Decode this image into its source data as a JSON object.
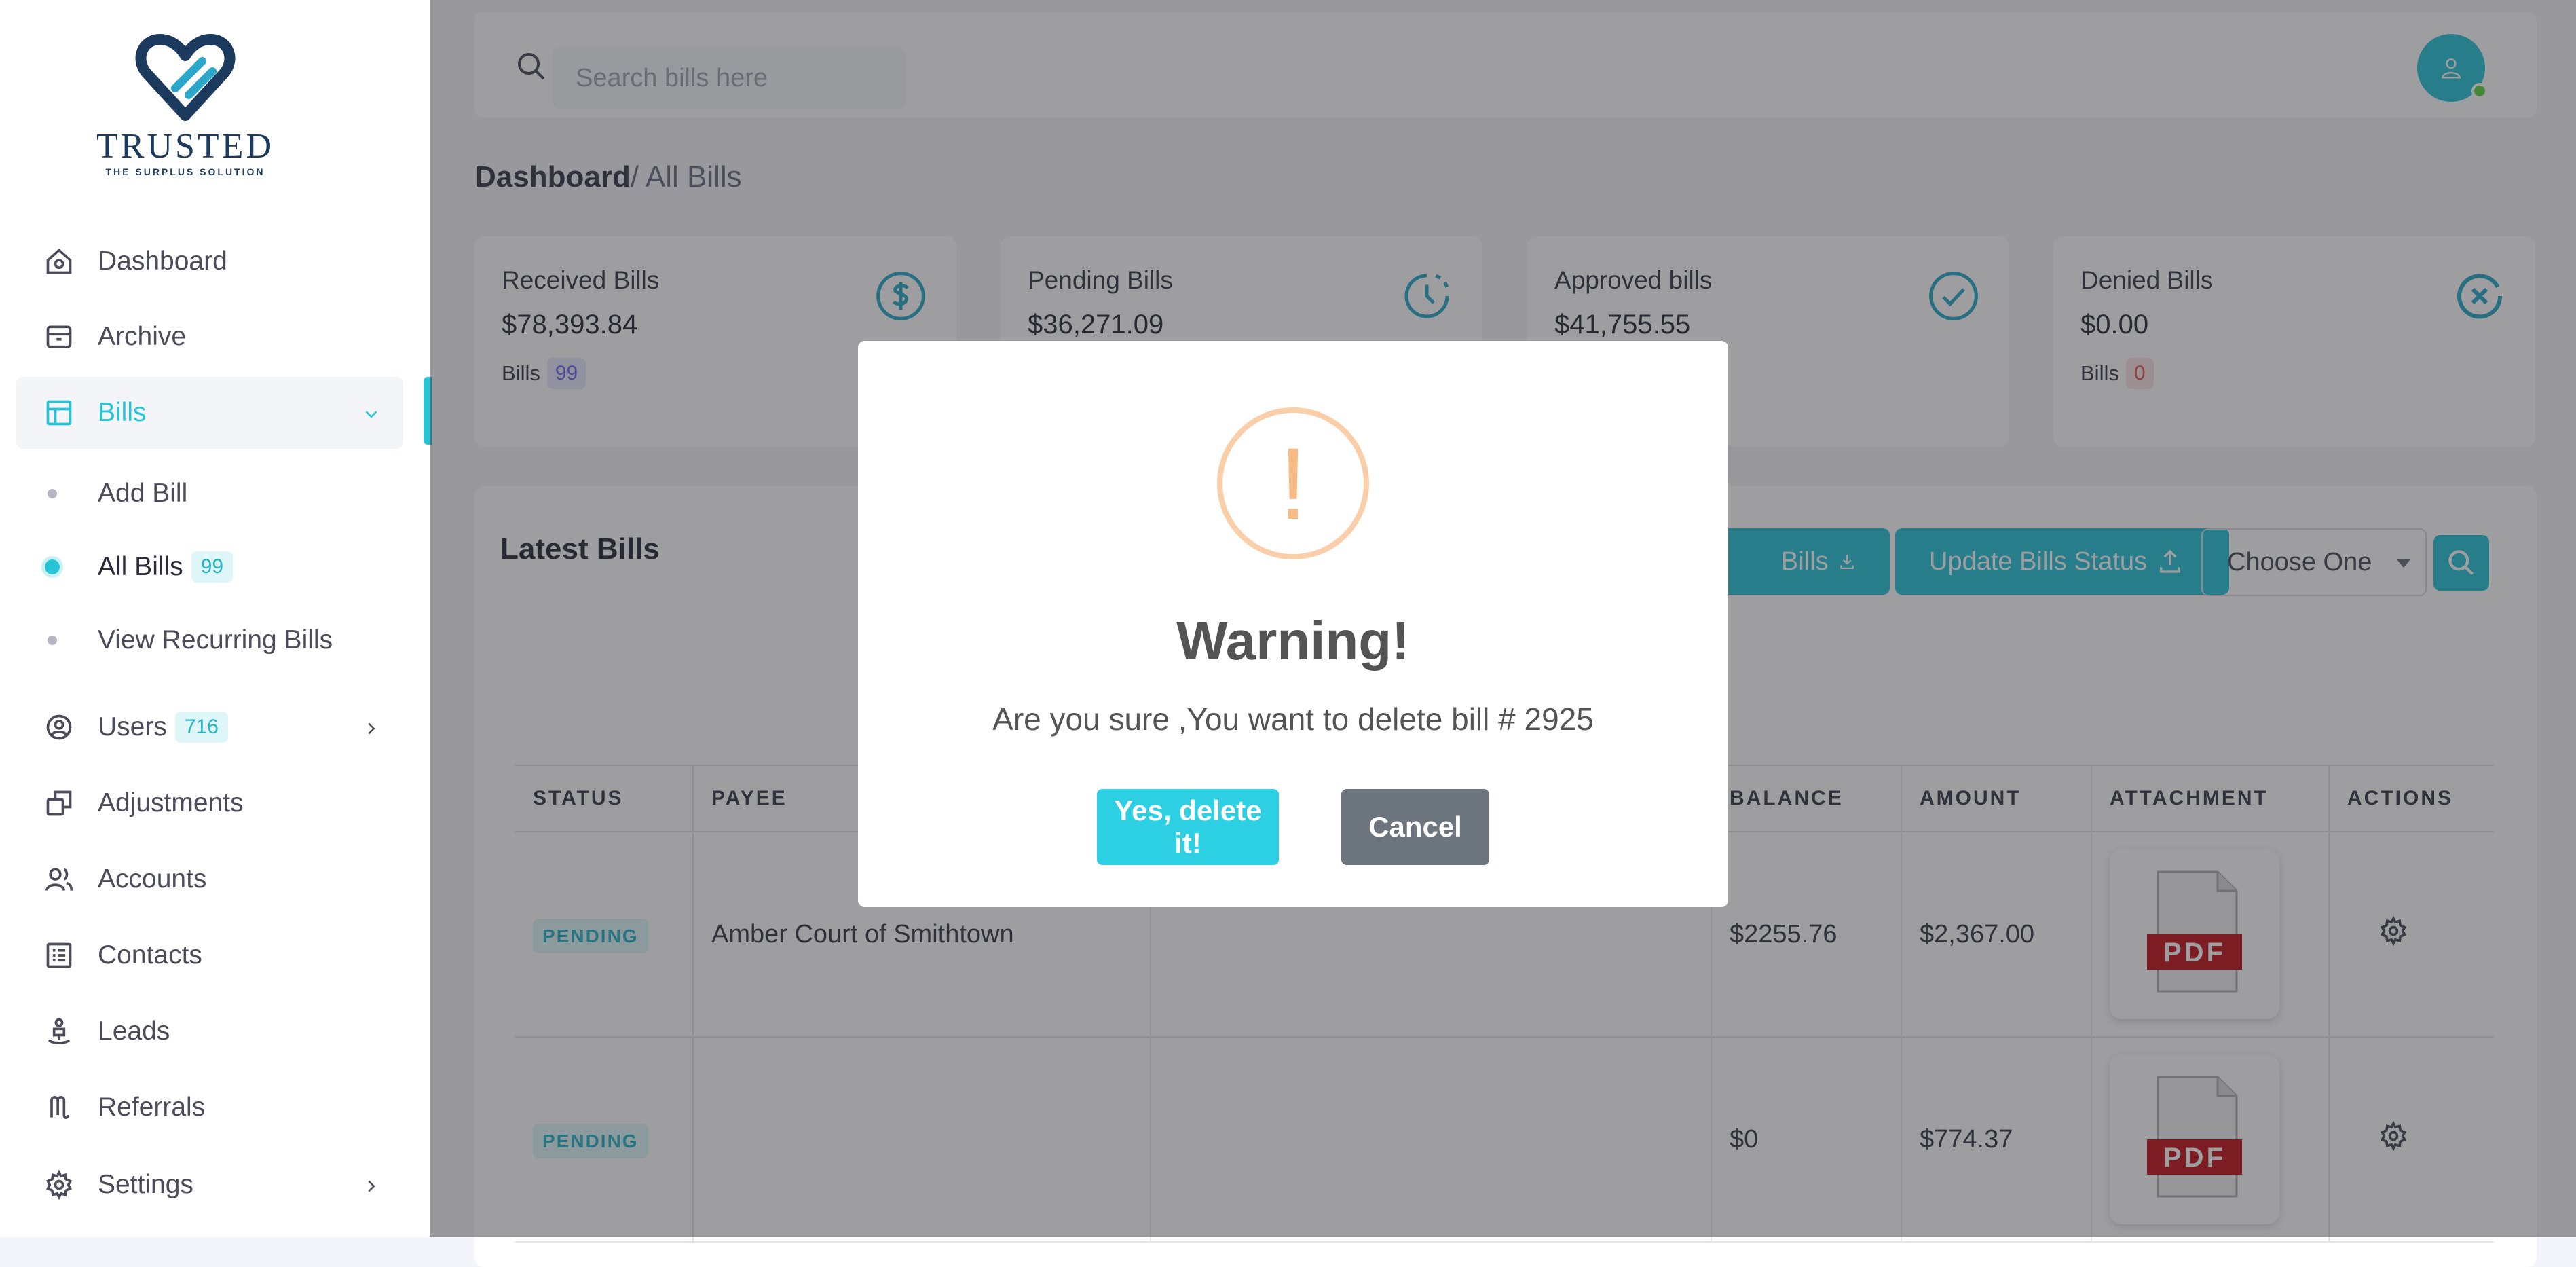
{
  "logo": {
    "brand": "TRUSTED",
    "tagline": "THE SURPLUS SOLUTION"
  },
  "sidebar": {
    "items": [
      {
        "label": "Dashboard",
        "icon": "home-icon"
      },
      {
        "label": "Archive",
        "icon": "archive-icon"
      },
      {
        "label": "Bills",
        "icon": "layout-icon",
        "active": true
      },
      {
        "label": "Users",
        "icon": "user-circle-icon",
        "badge": "716"
      },
      {
        "label": "Adjustments",
        "icon": "copy-icon"
      },
      {
        "label": "Accounts",
        "icon": "users-icon"
      },
      {
        "label": "Contacts",
        "icon": "list-icon"
      },
      {
        "label": "Leads",
        "icon": "lead-icon"
      },
      {
        "label": "Referrals",
        "icon": "referral-icon"
      },
      {
        "label": "Settings",
        "icon": "gear-icon"
      }
    ],
    "bills_sub": [
      {
        "label": "Add Bill"
      },
      {
        "label": "All Bills",
        "badge": "99",
        "active": true
      },
      {
        "label": "View Recurring Bills"
      }
    ]
  },
  "search": {
    "placeholder": "Search bills here"
  },
  "breadcrumb": {
    "root": "Dashboard",
    "current": "/ All Bills"
  },
  "cards": [
    {
      "title": "Received Bills",
      "value": "$78,393.84",
      "foot_label": "Bills",
      "foot_badge": "99",
      "badge_color": "#7367f0"
    },
    {
      "title": "Pending Bills",
      "value": "$36,271.09"
    },
    {
      "title": "Approved bills",
      "value": "$41,755.55"
    },
    {
      "title": "Denied Bills",
      "value": "$0.00",
      "foot_label": "Bills",
      "foot_badge": "0",
      "badge_color": "#ea5455"
    }
  ],
  "panel": {
    "title": "Latest Bills",
    "export_label": "Bills",
    "update_label": "Update Bills Status",
    "select_value": "Choose One"
  },
  "table": {
    "headers": [
      "STATUS",
      "PAYEE",
      "",
      "BALANCE",
      "AMOUNT",
      "ATTACHMENT",
      "ACTIONS"
    ],
    "rows": [
      {
        "status": "PENDING",
        "payee": "Amber Court of Smithtown",
        "balance": "$2255.76",
        "amount": "$2,367.00",
        "attachment": "PDF"
      },
      {
        "status": "PENDING",
        "payee": "",
        "balance": "$0",
        "amount": "$774.37",
        "attachment": "PDF"
      }
    ]
  },
  "modal": {
    "icon": "!",
    "title": "Warning!",
    "text": "Are you sure ,You want to delete bill # 2925",
    "confirm": "Yes, delete it!",
    "cancel": "Cancel"
  },
  "colors": {
    "accent": "#27c3d6",
    "warning": "#f8bb86",
    "cancel": "#6c757d"
  }
}
